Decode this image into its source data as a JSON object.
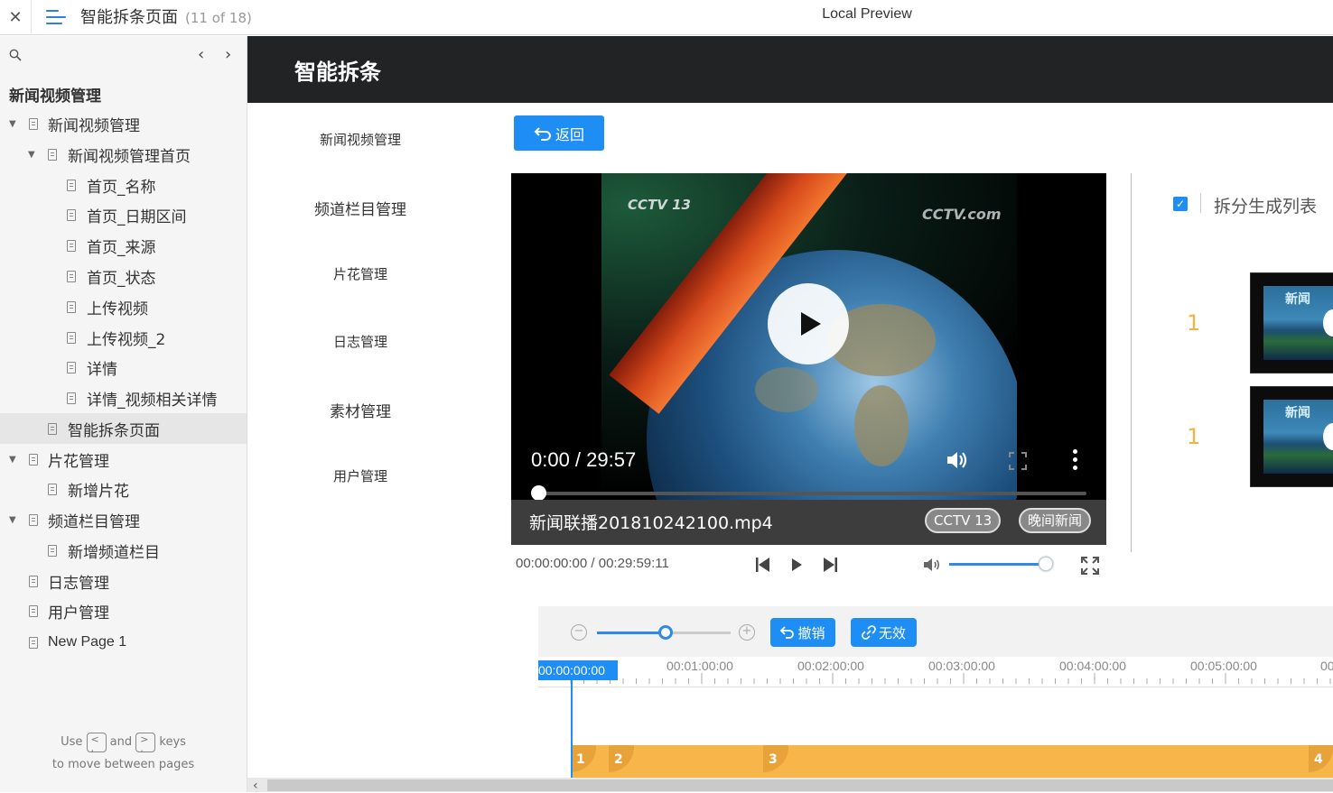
{
  "topbar": {
    "page_title": "智能拆条页面",
    "page_count": "(11 of 18)",
    "center_title": "Local Preview"
  },
  "sidebar": {
    "section_title": "新闻视频管理",
    "items": [
      {
        "label": "新闻视频管理"
      },
      {
        "label": "新闻视频管理首页"
      },
      {
        "label": "首页_名称"
      },
      {
        "label": "首页_日期区间"
      },
      {
        "label": "首页_来源"
      },
      {
        "label": "首页_状态"
      },
      {
        "label": "上传视频"
      },
      {
        "label": "上传视频_2"
      },
      {
        "label": "详情"
      },
      {
        "label": "详情_视频相关详情"
      },
      {
        "label": "智能拆条页面"
      },
      {
        "label": "片花管理"
      },
      {
        "label": "新增片花"
      },
      {
        "label": "频道栏目管理"
      },
      {
        "label": "新增频道栏目"
      },
      {
        "label": "日志管理"
      },
      {
        "label": "用户管理"
      },
      {
        "label": "New Page 1"
      }
    ],
    "hint_use": "Use",
    "hint_and": "and",
    "hint_keys": "keys",
    "hint_line2": "to move between pages"
  },
  "app": {
    "title": "智能拆条",
    "nav": [
      "新闻视频管理",
      "频道栏目管理",
      "片花管理",
      "日志管理",
      "素材管理",
      "用户管理"
    ],
    "back_label": "返回",
    "player": {
      "logo_left": "CCTV 13",
      "logo_right": "CCTV.com",
      "time": "0:00 / 29:57",
      "progress": 0,
      "filename": "新闻联播201810242100.mp4",
      "tags": [
        "CCTV 13",
        "晚间新闻"
      ]
    },
    "controls": {
      "timecode": "00:00:00:00 / 00:29:59:11",
      "volume": 0.9
    },
    "split_list": {
      "checked": true,
      "title": "拆分生成列表",
      "items": [
        {
          "num": "1",
          "thumb_text": "新闻"
        },
        {
          "num": "1",
          "thumb_text": "新闻"
        }
      ]
    },
    "timeline": {
      "undo_label": "撤销",
      "invalid_label": "无效",
      "zoom": 0.5,
      "current": "00:00:00:00",
      "ticks": [
        "00:01:00:00",
        "00:02:00:00",
        "00:03:00:00",
        "00:04:00:00",
        "00:05:00:00",
        "00"
      ],
      "segments": [
        "1",
        "2",
        "3",
        "4"
      ]
    }
  },
  "colors": {
    "accent": "#1e8ef5",
    "header_bg": "#212325",
    "segment": "#f8b54a",
    "number": "#f4b340"
  }
}
